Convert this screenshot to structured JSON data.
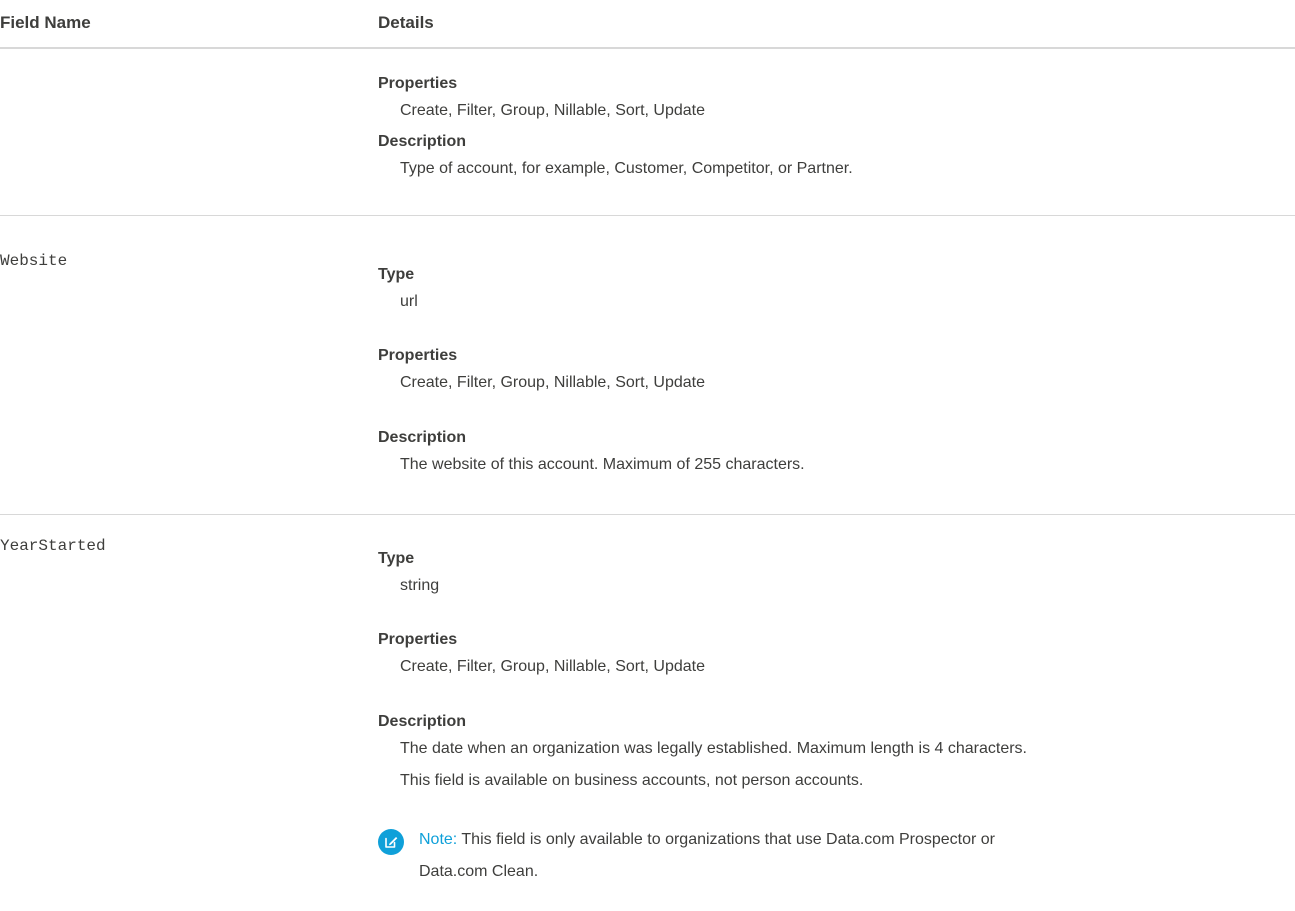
{
  "header": {
    "field_name": "Field Name",
    "details": "Details"
  },
  "rows": [
    {
      "field": "",
      "properties_label": "Properties",
      "properties": "Create, Filter, Group, Nillable, Sort, Update",
      "description_label": "Description",
      "description": "Type of account, for example, Customer, Competitor, or Partner."
    },
    {
      "field": "Website",
      "type_label": "Type",
      "type": "url",
      "properties_label": "Properties",
      "properties": "Create, Filter, Group, Nillable, Sort, Update",
      "description_label": "Description",
      "description": "The website of this account. Maximum of 255 characters."
    },
    {
      "field": "YearStarted",
      "type_label": "Type",
      "type": "string",
      "properties_label": "Properties",
      "properties": "Create, Filter, Group, Nillable, Sort, Update",
      "description_label": "Description",
      "description_line1": "The date when an organization was legally established. Maximum length is 4 characters.",
      "description_line2": "This field is available on business accounts, not person accounts.",
      "note_label": "Note:",
      "note_line1": "This field is only available to organizations that use Data.com Prospector or",
      "note_line2": "Data.com Clean.",
      "note_icon": "edit-note-icon",
      "note_color": "#0fa0d9"
    }
  ]
}
